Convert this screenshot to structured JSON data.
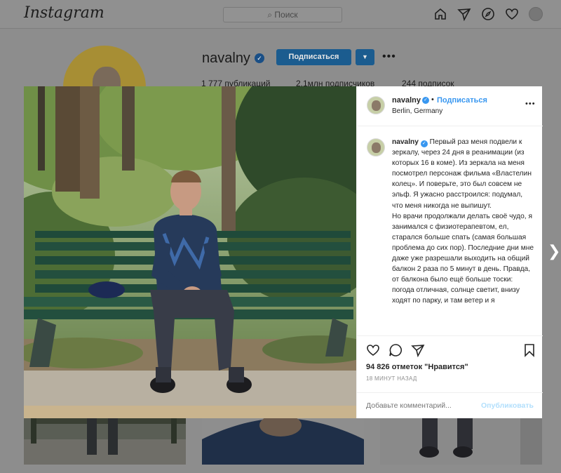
{
  "topbar": {
    "logo": "Instagram",
    "search_placeholder": "Поиск",
    "icons": [
      "home-icon",
      "direct-icon",
      "explore-icon",
      "activity-heart-icon",
      "profile-avatar"
    ]
  },
  "profile": {
    "username": "navalny",
    "follow_label": "Подписаться",
    "posts": "1 777 публикаций",
    "followers": "2,1млн подписчиков",
    "following": "244 подписок"
  },
  "post": {
    "username": "navalny",
    "separator": "•",
    "follow_label": "Подписаться",
    "location": "Berlin, Germany",
    "caption_username": "navalny",
    "caption_lines": [
      "Первый раз меня подвели к зеркалу, через 24 дня в реанимации (из которых 16 в коме). Из зеркала на меня посмотрел персонаж фильма «Властелин колец». И поверьте, это был совсем не эльф. Я ужасно расстроился: подумал, что меня никогда не выпишут.",
      "Но врачи продолжали делать своё чудо, я занимался с физиотерапевтом, ел, старался больше спать (самая большая проблема до сих пор). Последние дни мне даже уже разрешали выходить на общий балкон 2 раза по 5 минут в день. Правда, от балкона было ещё больше тоски: погода отличная, солнце светит, внизу ходят по парку, и там ветер и я"
    ],
    "likes": "94 826 отметок \"Нравится\"",
    "time": "18 МИНУТ НАЗАД",
    "comment_placeholder": "Добавьте комментарий...",
    "publish_label": "Опубликовать"
  },
  "colors": {
    "accent": "#3897f0",
    "publish_disabled": "#b2dffc",
    "overlay": "#8d8d8d"
  }
}
